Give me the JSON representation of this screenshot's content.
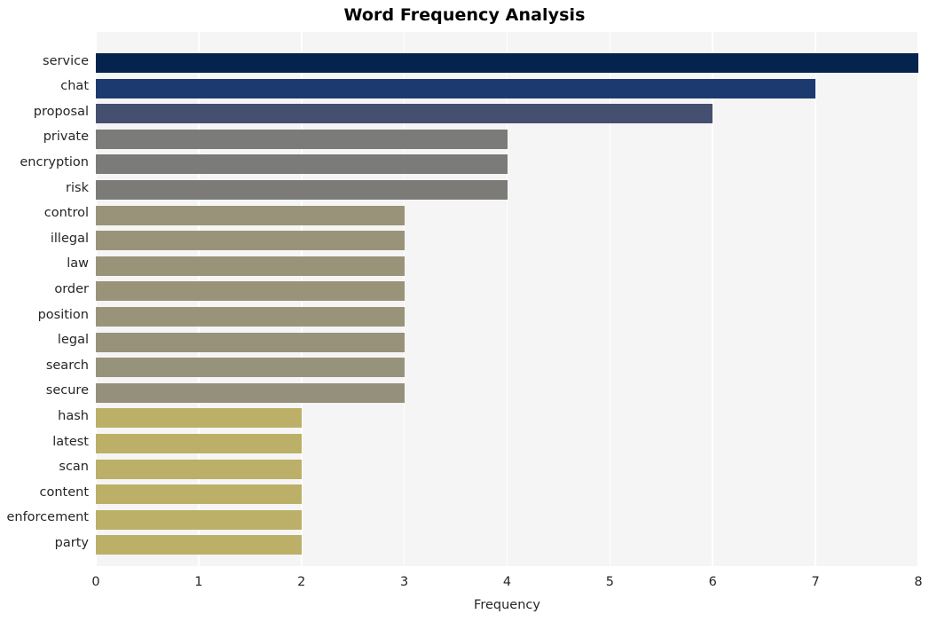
{
  "chart_data": {
    "type": "bar",
    "orientation": "horizontal",
    "title": "Word Frequency Analysis",
    "xlabel": "Frequency",
    "ylabel": "",
    "xlim": [
      0,
      8
    ],
    "xticks": [
      0,
      1,
      2,
      3,
      4,
      5,
      6,
      7,
      8
    ],
    "xticklabels": [
      "0",
      "1",
      "2",
      "3",
      "4",
      "5",
      "6",
      "7",
      "8"
    ],
    "grid": true,
    "grid_axis": "x",
    "legend": false,
    "plot_background": "#f5f5f5",
    "grid_color": "#ffffff",
    "figure_background": "#ffffff",
    "categories": [
      "service",
      "chat",
      "proposal",
      "private",
      "encryption",
      "risk",
      "control",
      "illegal",
      "law",
      "order",
      "position",
      "legal",
      "search",
      "secure",
      "hash",
      "latest",
      "scan",
      "content",
      "enforcement",
      "party"
    ],
    "values": [
      8,
      7,
      6,
      4,
      4,
      4,
      3,
      3,
      3,
      3,
      3,
      3,
      3,
      3,
      2,
      2,
      2,
      2,
      2,
      2
    ],
    "bar_colors": [
      "#04244d",
      "#1d3a70",
      "#454f70",
      "#7b7b79",
      "#7b7b79",
      "#7c7b78",
      "#99937a",
      "#99937a",
      "#99937a",
      "#99937a",
      "#99937a",
      "#98927a",
      "#97927b",
      "#95907b",
      "#bcaf67",
      "#bcaf67",
      "#bcaf67",
      "#bcaf67",
      "#bcaf67",
      "#bcaf67"
    ]
  }
}
